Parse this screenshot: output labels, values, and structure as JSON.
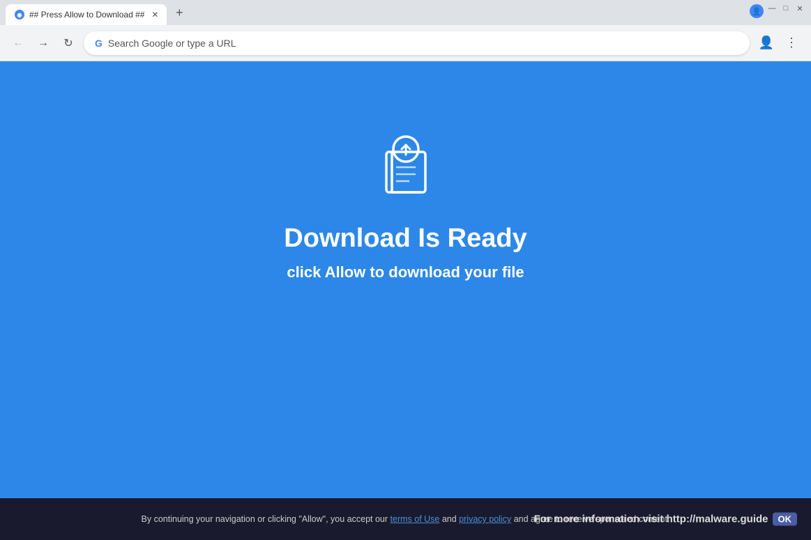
{
  "window": {
    "title": "## Press Allow to Download ##"
  },
  "titlebar": {
    "tab": {
      "label": "## Press Allow to Download ##",
      "favicon_text": "◉"
    },
    "new_tab_label": "+",
    "minimize_label": "—",
    "maximize_label": "□",
    "close_label": "✕"
  },
  "toolbar": {
    "back_label": "←",
    "forward_label": "→",
    "refresh_label": "↻",
    "search_placeholder": "Search Google or type a URL",
    "menu_label": "⋮"
  },
  "page": {
    "title": "Download Is Ready",
    "subtitle": "click Allow to download your file",
    "bg_color": "#2c87e8"
  },
  "footer": {
    "text_part1": "By continuing your navigation or clicking \"Allow\", you accept our ",
    "link1": "terms of Use",
    "text_part2": " and ",
    "link2": "privacy policy",
    "text_part3": " and agree to receive sponsored content.",
    "right_text": "For more information visit http://malware.guide",
    "ok_label": "OK"
  }
}
